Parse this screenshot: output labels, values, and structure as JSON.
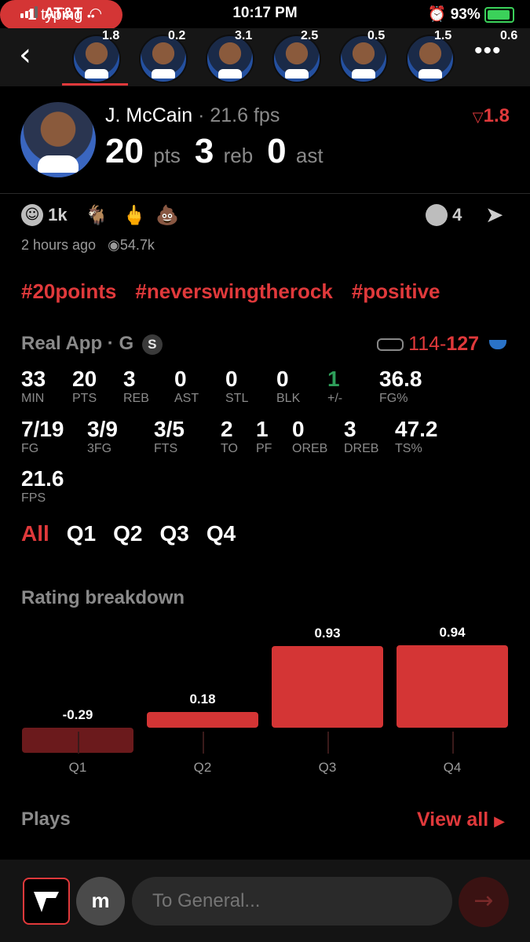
{
  "status_bar": {
    "carrier": "AT&T",
    "time": "10:17 PM",
    "battery": "93%"
  },
  "player_strip": {
    "values": [
      "1.8",
      "0.2",
      "3.1",
      "2.5",
      "0.5",
      "1.5",
      "0.6"
    ]
  },
  "player": {
    "name": "J. McCain",
    "fps_label": "· 21.6 fps",
    "rating": "1.8",
    "pts": "20",
    "pts_unit": "pts",
    "reb": "3",
    "reb_unit": "reb",
    "ast": "0",
    "ast_unit": "ast"
  },
  "reactions": {
    "smile_count": "1k",
    "comment_count": "4",
    "time_ago": "2 hours ago",
    "views": "54.7k"
  },
  "tags": [
    "#20points",
    "#neverswingtherock",
    "#positive"
  ],
  "game": {
    "label": "Real App · G",
    "badge": "S",
    "score_home": "114",
    "score_sep": "-",
    "score_away": "127"
  },
  "stats_row1": [
    {
      "v": "33",
      "l": "MIN"
    },
    {
      "v": "20",
      "l": "PTS"
    },
    {
      "v": "3",
      "l": "REB"
    },
    {
      "v": "0",
      "l": "AST"
    },
    {
      "v": "0",
      "l": "STL"
    },
    {
      "v": "0",
      "l": "BLK"
    },
    {
      "v": "1",
      "l": "+/-"
    },
    {
      "v": "36.8",
      "l": "FG%"
    }
  ],
  "stats_row2": [
    {
      "v": "7/19",
      "l": "FG"
    },
    {
      "v": "3/9",
      "l": "3FG"
    },
    {
      "v": "3/5",
      "l": "FTS"
    },
    {
      "v": "2",
      "l": "TO"
    },
    {
      "v": "1",
      "l": "PF"
    },
    {
      "v": "0",
      "l": "OREB"
    },
    {
      "v": "3",
      "l": "DREB"
    },
    {
      "v": "47.2",
      "l": "TS%"
    }
  ],
  "stats_row3": [
    {
      "v": "21.6",
      "l": "FPS"
    }
  ],
  "quarter_tabs": [
    "All",
    "Q1",
    "Q2",
    "Q3",
    "Q4"
  ],
  "rating_breakdown": {
    "title": "Rating breakdown",
    "quarters": [
      "Q1",
      "Q2",
      "Q3",
      "Q4"
    ],
    "values": [
      -0.29,
      0.18,
      0.93,
      0.94
    ],
    "labels": [
      "-0.29",
      "0.18",
      "0.93",
      "0.94"
    ]
  },
  "plays": {
    "title": "Plays",
    "view_all": "View all"
  },
  "typing": {
    "count": "1",
    "text": "typing"
  },
  "composer": {
    "m_label": "m",
    "placeholder": "To General..."
  },
  "colors": {
    "accent": "#e0393b",
    "bar": "#d43535",
    "neg_bar": "#6b1a1c",
    "positive": "#2e9e5a"
  }
}
